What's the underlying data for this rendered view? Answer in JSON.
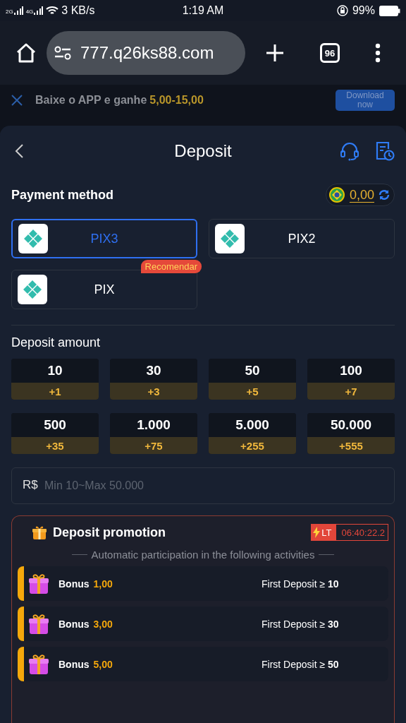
{
  "status_bar": {
    "network_1": "2G",
    "network_2": "4G",
    "speed": "3 KB/s",
    "time": "1:19 AM",
    "battery": "99%"
  },
  "browser": {
    "url": "777.q26ks88.com",
    "tab_count": "96"
  },
  "banner": {
    "text": "Baixe o APP e ganhe",
    "amount": "5,00-15,00",
    "button": "Download now"
  },
  "header": {
    "title": "Deposit"
  },
  "payment": {
    "label": "Payment method",
    "balance": "0,00",
    "methods": [
      {
        "name": "PIX3",
        "selected": true
      },
      {
        "name": "PIX2",
        "selected": false
      },
      {
        "name": "PIX",
        "selected": false,
        "badge": "Recomendar"
      }
    ]
  },
  "amount": {
    "label": "Deposit amount",
    "options": [
      {
        "value": "10",
        "bonus": "+1"
      },
      {
        "value": "30",
        "bonus": "+3"
      },
      {
        "value": "50",
        "bonus": "+5"
      },
      {
        "value": "100",
        "bonus": "+7"
      },
      {
        "value": "500",
        "bonus": "+35"
      },
      {
        "value": "1.000",
        "bonus": "+75"
      },
      {
        "value": "5.000",
        "bonus": "+255"
      },
      {
        "value": "50.000",
        "bonus": "+555"
      }
    ],
    "currency": "R$",
    "placeholder": "Min 10~Max 50.000"
  },
  "promotion": {
    "title": "Deposit promotion",
    "tag": "LT",
    "countdown": "06:40:22.2",
    "subtitle": "Automatic participation in the following activities",
    "items": [
      {
        "label": "Bonus",
        "amount": "1,00",
        "condition": "First Deposit ≥ **10**"
      },
      {
        "label": "Bonus",
        "amount": "3,00",
        "condition": "First Deposit ≥ **30**"
      },
      {
        "label": "Bonus",
        "amount": "5,00",
        "condition": "First Deposit ≥ **50**"
      }
    ]
  }
}
